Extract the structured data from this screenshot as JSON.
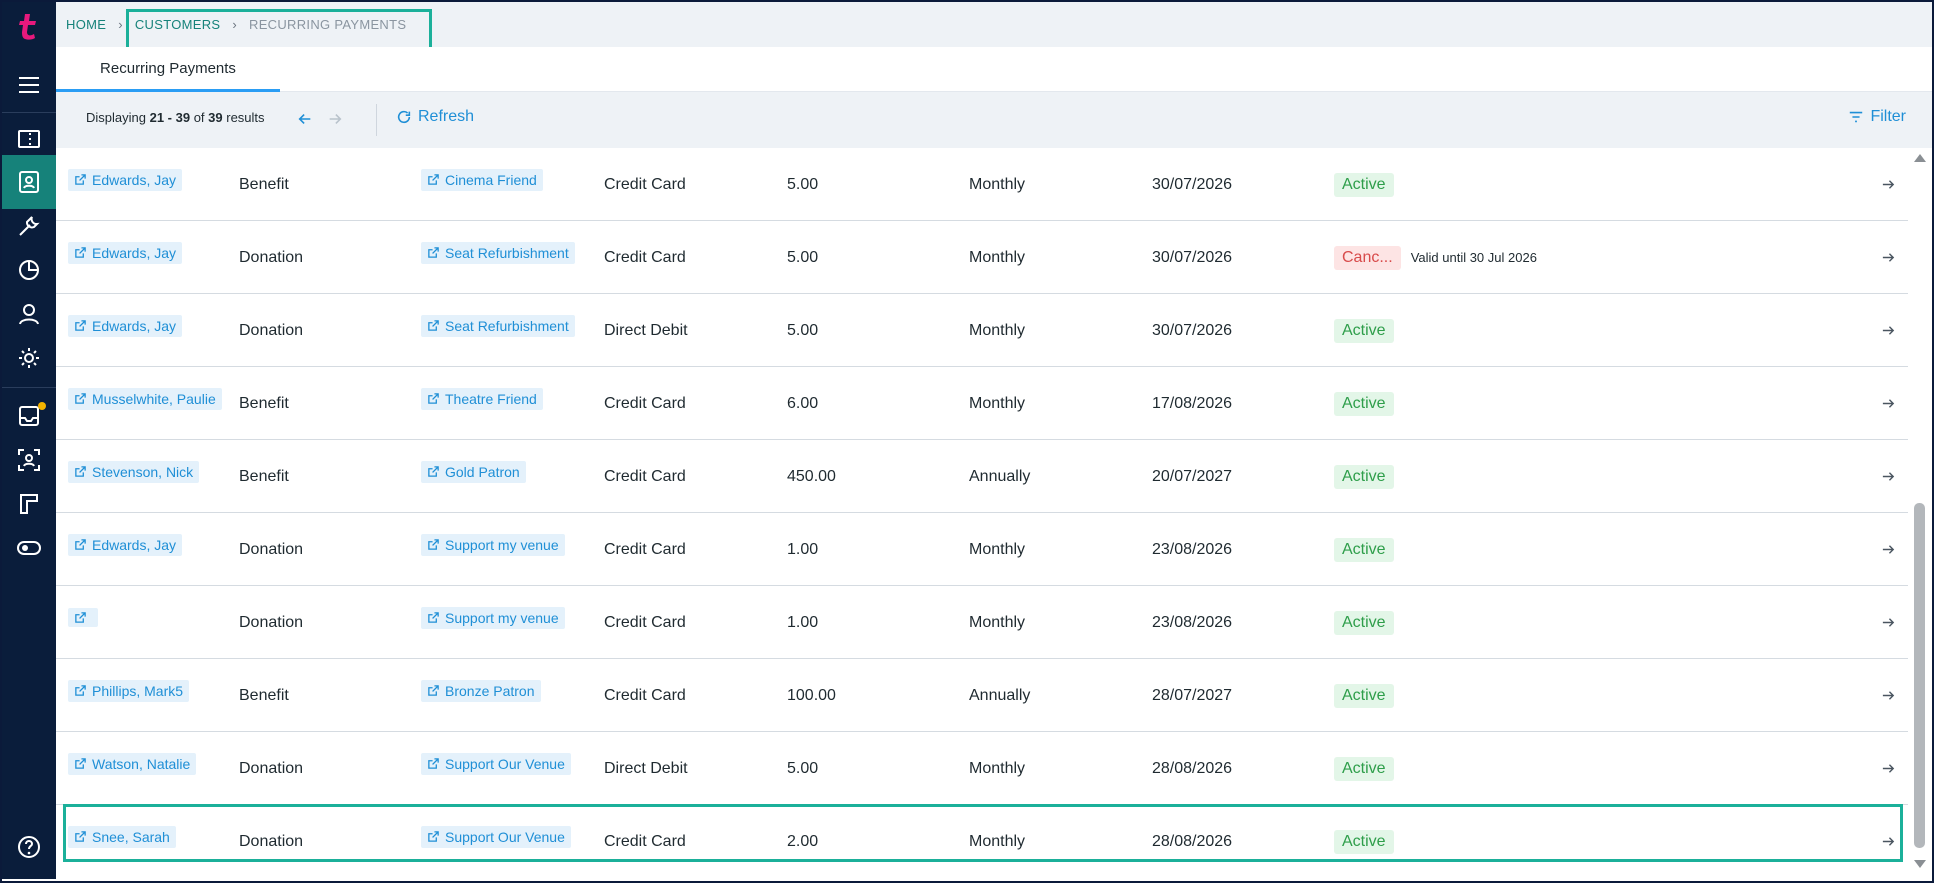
{
  "breadcrumb": {
    "home": "HOME",
    "customers": "CUSTOMERS",
    "current": "RECURRING PAYMENTS",
    "separator": "›"
  },
  "tabs": [
    {
      "label": "Recurring Payments"
    }
  ],
  "toolbar": {
    "displaying_prefix": "Displaying ",
    "range": "21 - 39",
    "of_label": " of ",
    "total": "39",
    "results_label": " results",
    "refresh_label": "Refresh",
    "filter_label": "Filter"
  },
  "colors": {
    "accent": "#16827a",
    "link": "#1f8fd6",
    "sidebar": "#0a1d3b",
    "active": "#2e9e4a",
    "cancelled": "#d84a4a",
    "highlight": "#1bb09a"
  },
  "sidebar": {
    "icons": [
      "logo-icon",
      "menu-icon",
      "tickets-icon",
      "contacts-icon",
      "tools-icon",
      "reports-icon",
      "user-icon",
      "settings-icon",
      "inbox-icon",
      "scan-user-icon",
      "layout-icon",
      "toggle-icon",
      "help-icon"
    ],
    "active": "contacts-icon"
  },
  "rows": [
    {
      "customer": "Edwards, Jay",
      "type": "Benefit",
      "product": "Cinema Friend",
      "method": "Credit Card",
      "amount": "5.00",
      "frequency": "Monthly",
      "date": "30/07/2026",
      "status": "Active",
      "status_kind": "active",
      "note": ""
    },
    {
      "customer": "Edwards, Jay",
      "type": "Donation",
      "product": "Seat Refurbishment",
      "method": "Credit Card",
      "amount": "5.00",
      "frequency": "Monthly",
      "date": "30/07/2026",
      "status": "Canc...",
      "status_kind": "cancel",
      "note": "Valid until 30 Jul 2026"
    },
    {
      "customer": "Edwards, Jay",
      "type": "Donation",
      "product": "Seat Refurbishment",
      "method": "Direct Debit",
      "amount": "5.00",
      "frequency": "Monthly",
      "date": "30/07/2026",
      "status": "Active",
      "status_kind": "active",
      "note": ""
    },
    {
      "customer": "Musselwhite, Paulie",
      "type": "Benefit",
      "product": "Theatre Friend",
      "method": "Credit Card",
      "amount": "6.00",
      "frequency": "Monthly",
      "date": "17/08/2026",
      "status": "Active",
      "status_kind": "active",
      "note": ""
    },
    {
      "customer": "Stevenson, Nick",
      "type": "Benefit",
      "product": "Gold Patron",
      "method": "Credit Card",
      "amount": "450.00",
      "frequency": "Annually",
      "date": "20/07/2027",
      "status": "Active",
      "status_kind": "active",
      "note": ""
    },
    {
      "customer": "Edwards, Jay",
      "type": "Donation",
      "product": "Support my venue",
      "method": "Credit Card",
      "amount": "1.00",
      "frequency": "Monthly",
      "date": "23/08/2026",
      "status": "Active",
      "status_kind": "active",
      "note": ""
    },
    {
      "customer": "",
      "type": "Donation",
      "product": "Support my venue",
      "method": "Credit Card",
      "amount": "1.00",
      "frequency": "Monthly",
      "date": "23/08/2026",
      "status": "Active",
      "status_kind": "active",
      "note": ""
    },
    {
      "customer": "Phillips, Mark5",
      "type": "Benefit",
      "product": "Bronze Patron",
      "method": "Credit Card",
      "amount": "100.00",
      "frequency": "Annually",
      "date": "28/07/2027",
      "status": "Active",
      "status_kind": "active",
      "note": ""
    },
    {
      "customer": "Watson, Natalie",
      "type": "Donation",
      "product": "Support Our Venue",
      "method": "Direct Debit",
      "amount": "5.00",
      "frequency": "Monthly",
      "date": "28/08/2026",
      "status": "Active",
      "status_kind": "active",
      "note": ""
    },
    {
      "customer": "Snee, Sarah",
      "type": "Donation",
      "product": "Support Our Venue",
      "method": "Credit Card",
      "amount": "2.00",
      "frequency": "Monthly",
      "date": "28/08/2026",
      "status": "Active",
      "status_kind": "active",
      "note": ""
    }
  ]
}
